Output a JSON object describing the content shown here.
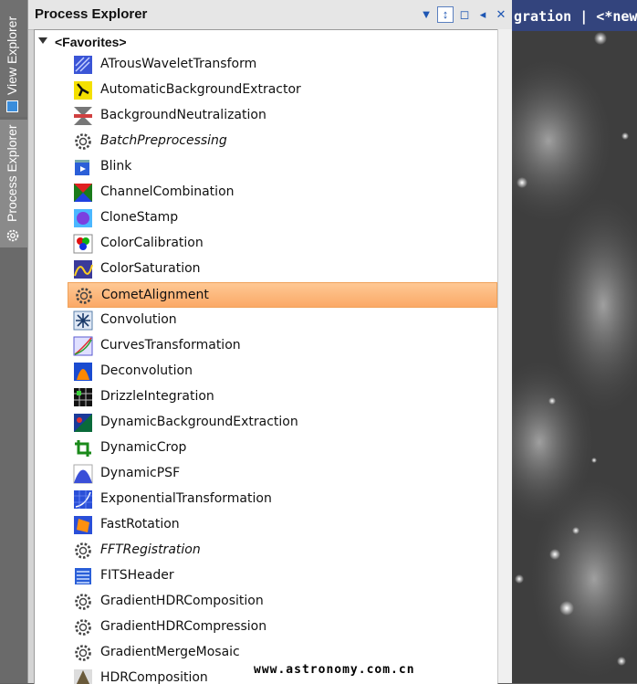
{
  "side_tabs": {
    "view_explorer": "View Explorer",
    "process_explorer": "Process Explorer"
  },
  "panel": {
    "title": "Process Explorer",
    "group_label": "<Favorites>"
  },
  "items": [
    {
      "label": "ATrousWaveletTransform",
      "icon": "wavelet-icon",
      "italic": false
    },
    {
      "label": "AutomaticBackgroundExtractor",
      "icon": "abe-icon",
      "italic": false
    },
    {
      "label": "BackgroundNeutralization",
      "icon": "background-neutralization-icon",
      "italic": false
    },
    {
      "label": "BatchPreprocessing",
      "icon": "gear-icon",
      "italic": true
    },
    {
      "label": "Blink",
      "icon": "blink-icon",
      "italic": false
    },
    {
      "label": "ChannelCombination",
      "icon": "channel-combination-icon",
      "italic": false
    },
    {
      "label": "CloneStamp",
      "icon": "clone-stamp-icon",
      "italic": false
    },
    {
      "label": "ColorCalibration",
      "icon": "color-calibration-icon",
      "italic": false
    },
    {
      "label": "ColorSaturation",
      "icon": "color-saturation-icon",
      "italic": false
    },
    {
      "label": "CometAlignment",
      "icon": "gear-icon",
      "italic": false,
      "selected": true
    },
    {
      "label": "Convolution",
      "icon": "convolution-icon",
      "italic": false
    },
    {
      "label": "CurvesTransformation",
      "icon": "curves-icon",
      "italic": false
    },
    {
      "label": "Deconvolution",
      "icon": "deconvolution-icon",
      "italic": false
    },
    {
      "label": "DrizzleIntegration",
      "icon": "drizzle-icon",
      "italic": false
    },
    {
      "label": "DynamicBackgroundExtraction",
      "icon": "dbe-icon",
      "italic": false
    },
    {
      "label": "DynamicCrop",
      "icon": "crop-icon",
      "italic": false
    },
    {
      "label": "DynamicPSF",
      "icon": "psf-icon",
      "italic": false
    },
    {
      "label": "ExponentialTransformation",
      "icon": "exponential-icon",
      "italic": false
    },
    {
      "label": "FastRotation",
      "icon": "rotation-icon",
      "italic": false
    },
    {
      "label": "FFTRegistration",
      "icon": "gear-icon",
      "italic": true
    },
    {
      "label": "FITSHeader",
      "icon": "fits-header-icon",
      "italic": false
    },
    {
      "label": "GradientHDRComposition",
      "icon": "gear-icon",
      "italic": false
    },
    {
      "label": "GradientHDRCompression",
      "icon": "gear-icon",
      "italic": false
    },
    {
      "label": "GradientMergeMosaic",
      "icon": "gear-icon",
      "italic": false
    },
    {
      "label": "HDRComposition",
      "icon": "hdr-icon",
      "italic": false
    }
  ],
  "image_window": {
    "title": "gration | <*new"
  },
  "watermark": "www.astronomy.com.cn",
  "colors": {
    "selection": "#fdb878",
    "title_bar": "#33447d",
    "header_icons": "#1e56b3"
  }
}
